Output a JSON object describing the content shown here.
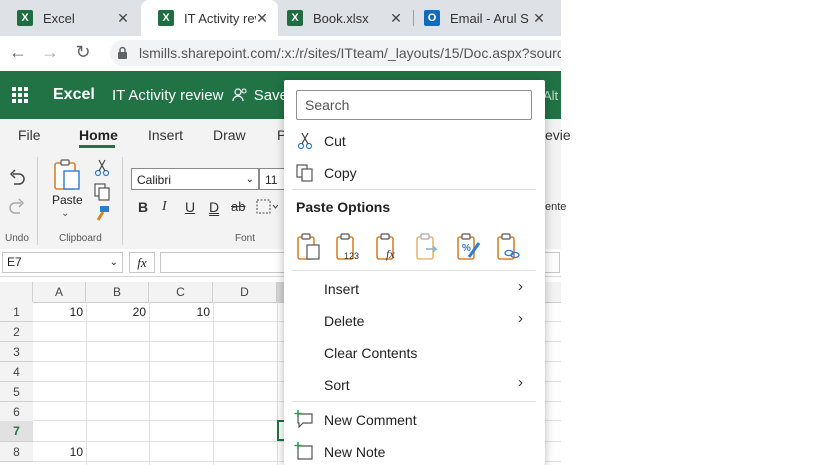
{
  "browser": {
    "tabs": [
      {
        "title": "Excel",
        "icon": "excel-icon"
      },
      {
        "title": "IT Activity rev",
        "icon": "excel-icon"
      },
      {
        "title": "Book.xlsx",
        "icon": "excel-icon"
      },
      {
        "title": "Email - Arul S",
        "icon": "outlook-icon"
      }
    ],
    "close_glyph": "✕",
    "url": "lsmills.sharepoint.com/:x:/r/sites/ITteam/_layouts/15/Doc.aspx?sourc"
  },
  "excel": {
    "brand": "Excel",
    "doc_title": "IT Activity review",
    "save_status": "Save",
    "alt_hint": "Alt",
    "ribbon_tabs": [
      "File",
      "Home",
      "Insert",
      "Draw",
      "P"
    ],
    "ribbon_tab_right": "evie",
    "active_tab": "Home",
    "groups": {
      "undo": "Undo",
      "clipboard": "Clipboard",
      "font": "Font"
    },
    "paste_label": "Paste",
    "font_name": "Calibri",
    "font_size": "11",
    "format_buttons": [
      "B",
      "I",
      "U",
      "D",
      "ab"
    ],
    "side_fragment": "ente",
    "name_box": "E7",
    "fx_label": "fx"
  },
  "grid": {
    "columns": [
      "A",
      "B",
      "C",
      "D"
    ],
    "rows": [
      "1",
      "2",
      "3",
      "4",
      "5",
      "6",
      "7",
      "8"
    ],
    "selected_row": "7",
    "cells": {
      "A1": "10",
      "B1": "20",
      "C1": "10",
      "A8": "10"
    }
  },
  "context_menu": {
    "search_placeholder": "Search",
    "cut": "Cut",
    "copy": "Copy",
    "paste_options": "Paste Options",
    "paste_icons": [
      "paste-icon",
      "paste-values-icon",
      "paste-formulas-icon",
      "paste-transpose-icon",
      "paste-formatting-icon",
      "paste-link-icon"
    ],
    "insert": "Insert",
    "delete": "Delete",
    "clear_contents": "Clear Contents",
    "sort": "Sort",
    "new_comment": "New Comment",
    "new_note": "New Note",
    "paste_values_sub": "123"
  },
  "colors": {
    "excel_green": "#217346",
    "paste_orange": "#d9822b",
    "paste_blue": "#2f7bd1"
  }
}
